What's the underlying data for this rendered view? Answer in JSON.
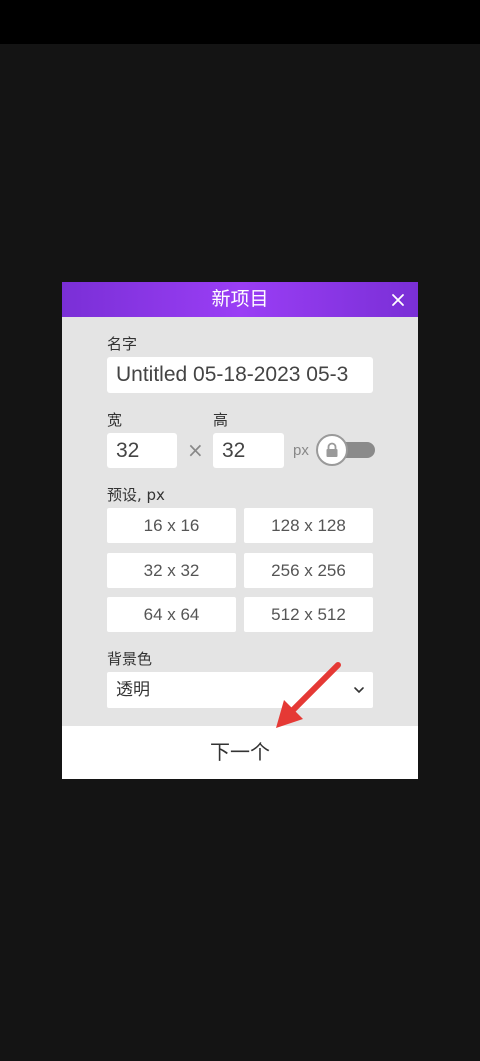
{
  "dialog": {
    "title": "新项目",
    "name_label": "名字",
    "name_value": "Untitled 05-18-2023 05-3",
    "width_label": "宽",
    "width_value": "32",
    "height_label": "高",
    "height_value": "32",
    "times_sign": "×",
    "unit": "px",
    "aspect_lock": false,
    "presets_label": "预设, px",
    "presets": [
      "16 x 16",
      "128 x 128",
      "32 x 32",
      "256 x 256",
      "64 x 64",
      "512 x 512"
    ],
    "background_label": "背景色",
    "background_value": "透明",
    "next_label": "下一个"
  },
  "colors": {
    "header_gradient_start": "#7a2fd6",
    "header_gradient_mid": "#9a3ef5",
    "dialog_background": "#e4e4e4",
    "page_background": "#141414",
    "annotation_arrow": "#e53935"
  },
  "icons": {
    "close": "close-icon",
    "lock": "lock-icon",
    "dropdown": "chevron-down-icon",
    "annotation": "annotation-arrow"
  }
}
